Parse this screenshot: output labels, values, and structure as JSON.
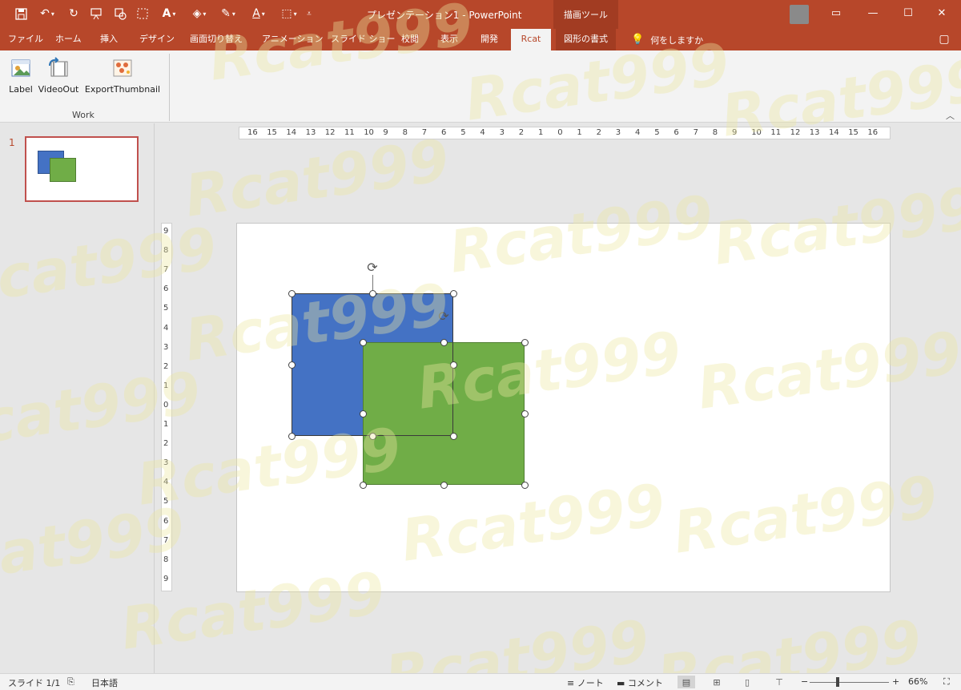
{
  "app": {
    "title": "プレゼンテーション1 - PowerPoint",
    "context_tool_group": "描画ツール"
  },
  "quick_access": {
    "icons": [
      "save-icon",
      "undo-icon",
      "redo-icon",
      "presenter-icon",
      "shape-icon",
      "font-color-icon",
      "fill-color-icon",
      "pen-icon",
      "text-color-icon",
      "select-icon",
      "customize-icon"
    ]
  },
  "ribbon_tabs": [
    "ファイル",
    "ホーム",
    "挿入",
    "デザイン",
    "画面切り替え",
    "アニメーション",
    "スライド ショー",
    "校閲",
    "表示",
    "開発",
    "Rcat",
    "図形の書式"
  ],
  "active_tab": "Rcat",
  "tell_me": "何をしますか",
  "ribbon": {
    "buttons": [
      "Label",
      "VideoOut",
      "ExportThumbnail"
    ],
    "group_label": "Work"
  },
  "slides": {
    "current_number": "1"
  },
  "ruler": {
    "horizontal": [
      "16",
      "15",
      "14",
      "13",
      "12",
      "11",
      "10",
      "9",
      "8",
      "7",
      "6",
      "5",
      "4",
      "3",
      "2",
      "1",
      "0",
      "1",
      "2",
      "3",
      "4",
      "5",
      "6",
      "7",
      "8",
      "9",
      "10",
      "11",
      "12",
      "13",
      "14",
      "15",
      "16"
    ],
    "vertical": [
      "9",
      "8",
      "7",
      "6",
      "5",
      "4",
      "3",
      "2",
      "1",
      "0",
      "1",
      "2",
      "3",
      "4",
      "5",
      "6",
      "7",
      "8",
      "9"
    ]
  },
  "shapes": [
    {
      "name": "blue-rectangle",
      "fill": "#4472C4"
    },
    {
      "name": "green-rectangle",
      "fill": "#70AD47"
    }
  ],
  "watermark": {
    "text": "Rcat999"
  },
  "status": {
    "slide_indicator": "スライド 1/1",
    "language": "日本語",
    "notes_label": "ノート",
    "comments_label": "コメント",
    "zoom_minus": "−",
    "zoom_plus": "+",
    "zoom": "66%",
    "zoom_fraction": 0.66
  },
  "colors": {
    "accent": "#B7472A",
    "ribbon_bg": "#F3F3F3"
  }
}
